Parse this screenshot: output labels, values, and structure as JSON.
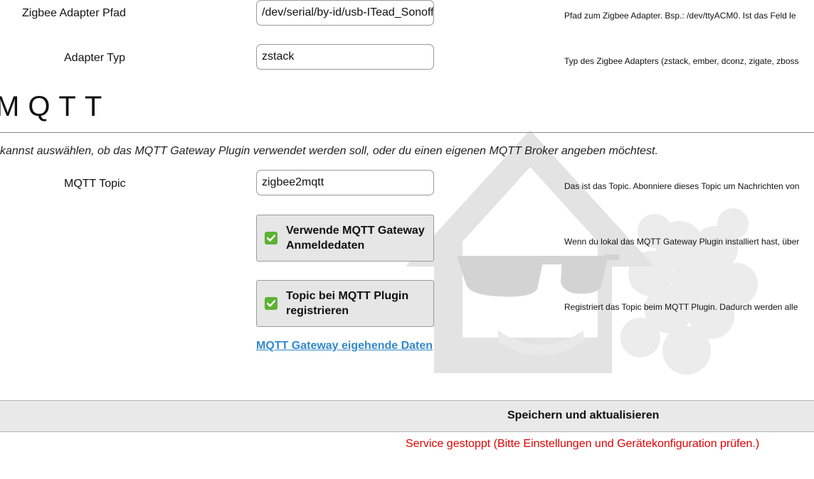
{
  "adapter": {
    "path_label": "Zigbee Adapter Pfad",
    "path_value": "/dev/serial/by-id/usb-ITead_Sonoff",
    "path_help": "Pfad zum Zigbee Adapter. Bsp.: /dev/ttyACM0. Ist das Feld le",
    "type_label": "Adapter Typ",
    "type_value": "zstack",
    "type_help": "Typ des Zigbee Adapters (zstack, ember, dconz, zigate, zboss"
  },
  "mqtt": {
    "title": "MQTT",
    "description": "kannst auswählen, ob das MQTT Gateway Plugin verwendet werden soll, oder du einen eigenen MQTT Broker angeben möchtest.",
    "topic_label": "MQTT Topic",
    "topic_value": "zigbee2mqtt",
    "topic_help": "Das ist das Topic. Abonniere dieses Topic um Nachrichten von",
    "use_credentials_label": "Verwende MQTT Gateway Anmeldedaten",
    "use_credentials_checked": true,
    "use_credentials_help": "Wenn du lokal das MQTT Gateway Plugin installiert hast, über",
    "register_topic_label": "Topic bei MQTT Plugin registrieren",
    "register_topic_checked": true,
    "register_topic_help": "Registriert das Topic beim MQTT Plugin. Dadurch werden alle",
    "gateway_link": "MQTT Gateway eigehende Daten"
  },
  "actions": {
    "save_label": "Speichern und aktualisieren"
  },
  "status": {
    "message": "Service gestoppt (Bitte Einstellungen und Gerätekonfiguration prüfen.)",
    "color": "#e00000"
  },
  "colors": {
    "checkbox": "#5cb233",
    "link": "#3388cc",
    "watermark": "#e8e8e8"
  },
  "icons": {
    "checkbox": "check-icon",
    "watermark": "loxberry-logo-icon"
  }
}
